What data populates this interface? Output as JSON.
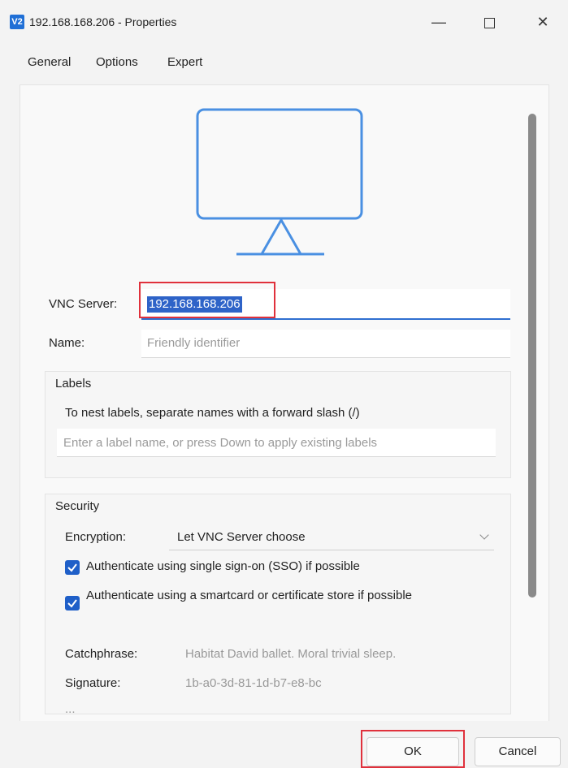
{
  "window": {
    "title": "192.168.168.206 - Properties",
    "app_icon_glyph": "V2",
    "minimize_label": "—",
    "close_label": "✕"
  },
  "tabs": [
    "General",
    "Options",
    "Expert"
  ],
  "server": {
    "label": "VNC Server:",
    "value": "192.168.168.206"
  },
  "name_field": {
    "label": "Name:",
    "placeholder": "Friendly identifier"
  },
  "labels_group": {
    "title": "Labels",
    "hint": "To nest labels, separate names with a forward slash (/)",
    "placeholder": "Enter a label name, or press Down to apply existing labels"
  },
  "security": {
    "title": "Security",
    "encryption_label": "Encryption:",
    "encryption_value": "Let VNC Server choose",
    "sso_checkbox_label": "Authenticate using single sign-on (SSO) if possible",
    "smartcard_checkbox_label": "Authenticate using a smartcard or certificate store if possible",
    "catchphrase_label": "Catchphrase:",
    "catchphrase_value": "Habitat David ballet. Moral trivial sleep.",
    "signature_label": "Signature:",
    "signature_value": "1b-a0-3d-81-1d-b7-e8-bc",
    "cutoff_text": "...",
    "sso_checked": true,
    "smartcard_checked": true
  },
  "buttons": {
    "ok": "OK",
    "cancel": "Cancel"
  },
  "colors": {
    "accent": "#1f5fc8",
    "highlight_box": "#e0313c"
  }
}
